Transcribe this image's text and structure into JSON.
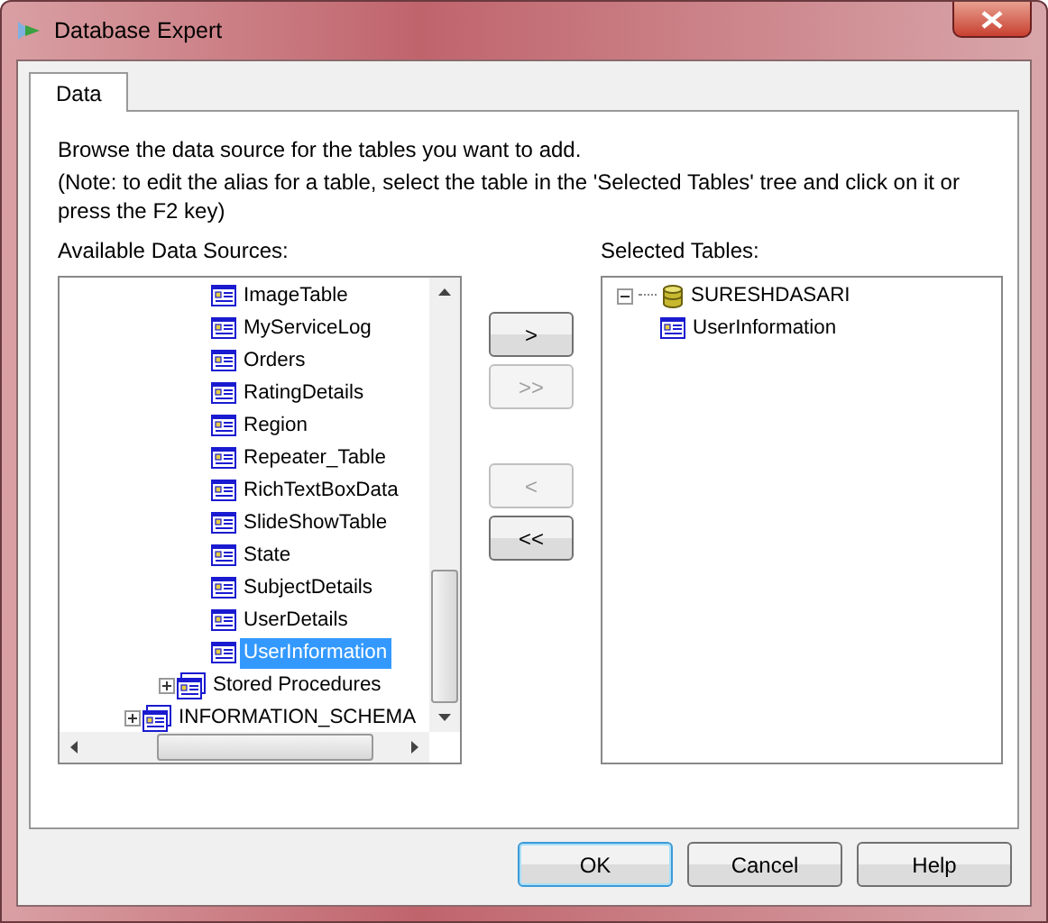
{
  "window": {
    "title": "Database Expert"
  },
  "tabs": [
    {
      "label": "Data",
      "selected": true
    }
  ],
  "intro": "Browse the data source for the tables you want to add.",
  "note": "(Note: to edit the alias for a table, select the table in the 'Selected Tables' tree and click on it or press the F2 key)",
  "available": {
    "label": "Available Data Sources:",
    "tree": [
      {
        "children": [
          {
            "children": [
              {
                "label": "ImageTable",
                "kind": "table",
                "selected": false
              },
              {
                "label": "MyServiceLog",
                "kind": "table",
                "selected": false
              },
              {
                "label": "Orders",
                "kind": "table",
                "selected": false
              },
              {
                "label": "RatingDetails",
                "kind": "table",
                "selected": false
              },
              {
                "label": "Region",
                "kind": "table",
                "selected": false
              },
              {
                "label": "Repeater_Table",
                "kind": "table",
                "selected": false
              },
              {
                "label": "RichTextBoxData",
                "kind": "table",
                "selected": false
              },
              {
                "label": "SlideShowTable",
                "kind": "table",
                "selected": false
              },
              {
                "label": "State",
                "kind": "table",
                "selected": false
              },
              {
                "label": "SubjectDetails",
                "kind": "table",
                "selected": false
              },
              {
                "label": "UserDetails",
                "kind": "table",
                "selected": false
              },
              {
                "label": "UserInformation",
                "kind": "table",
                "selected": true
              }
            ]
          },
          {
            "label": "Stored Procedures",
            "kind": "folder",
            "expanded": false,
            "selected": false
          }
        ]
      },
      {
        "label": "INFORMATION_SCHEMA",
        "kind": "folder",
        "expanded": false,
        "selected": false
      }
    ]
  },
  "move_buttons": [
    {
      "label": ">",
      "disabled": false
    },
    {
      "label": ">>",
      "disabled": true
    },
    {
      "label": "<",
      "disabled": true
    },
    {
      "label": "<<",
      "disabled": false
    }
  ],
  "selected_tables": {
    "label": "Selected Tables:",
    "tree": [
      {
        "label": "SURESHDASARI",
        "kind": "database",
        "expanded": true,
        "selected": false,
        "children": [
          {
            "label": "UserInformation",
            "kind": "table",
            "selected": false
          }
        ]
      }
    ]
  },
  "buttons": [
    {
      "label": "OK",
      "default": true
    },
    {
      "label": "Cancel",
      "default": false
    },
    {
      "label": "Help",
      "default": false
    }
  ]
}
